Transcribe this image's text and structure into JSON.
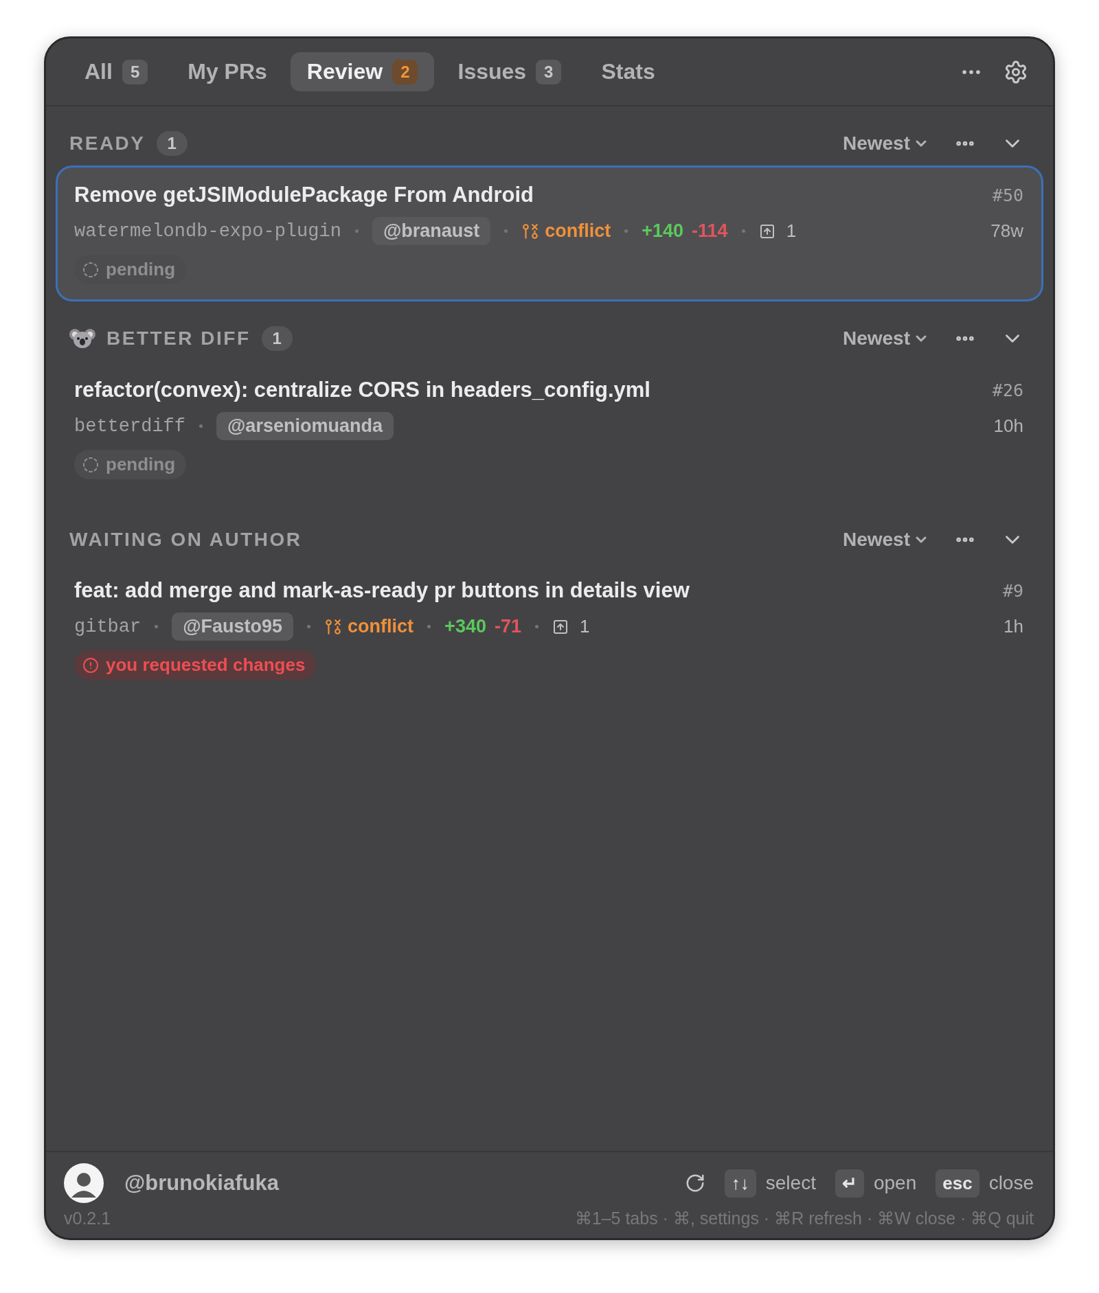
{
  "tabs": [
    {
      "label": "All",
      "count": "5",
      "selected": false
    },
    {
      "label": "My PRs",
      "selected": false
    },
    {
      "label": "Review",
      "count": "2",
      "selected": true
    },
    {
      "label": "Issues",
      "count": "3",
      "selected": false
    },
    {
      "label": "Stats",
      "selected": false
    }
  ],
  "sections": [
    {
      "kind": "state",
      "title": "READY",
      "count": "1",
      "sort": "Newest",
      "items": [
        {
          "title": "Remove getJSIModulePackage From Android",
          "number": "#50",
          "repo": "watermelondb-expo-plugin",
          "author": "@branaust",
          "conflict": "conflict",
          "additions": "+140",
          "deletions": "-114",
          "comments": "1",
          "age": "78w",
          "status": {
            "kind": "pending",
            "label": "pending"
          },
          "selected": true
        }
      ]
    },
    {
      "kind": "project",
      "title": "BETTER DIFF",
      "count": "1",
      "sort": "Newest",
      "items": [
        {
          "title": "refactor(convex): centralize CORS in headers_config.yml",
          "number": "#26",
          "repo": "betterdiff",
          "author": "@arseniomuanda",
          "age": "10h",
          "status": {
            "kind": "pending",
            "label": "pending"
          },
          "selected": false
        }
      ]
    },
    {
      "kind": "state",
      "title": "WAITING ON AUTHOR",
      "sort": "Newest",
      "items": [
        {
          "title": "feat: add merge and mark-as-ready pr buttons in details view",
          "number": "#9",
          "repo": "gitbar",
          "author": "@Fausto95",
          "conflict": "conflict",
          "additions": "+340",
          "deletions": "-71",
          "comments": "1",
          "age": "1h",
          "status": {
            "kind": "changes_requested",
            "label": "you requested changes"
          },
          "selected": false
        }
      ]
    }
  ],
  "footer": {
    "username": "@brunokiafuka",
    "keys": [
      {
        "key": "↑↓",
        "label": "select"
      },
      {
        "key": "↵",
        "label": "open"
      },
      {
        "key": "esc",
        "label": "close"
      }
    ],
    "version": "v0.2.1",
    "shortcuts": "⌘1–5 tabs · ⌘, settings · ⌘R refresh · ⌘W close · ⌘Q quit"
  }
}
